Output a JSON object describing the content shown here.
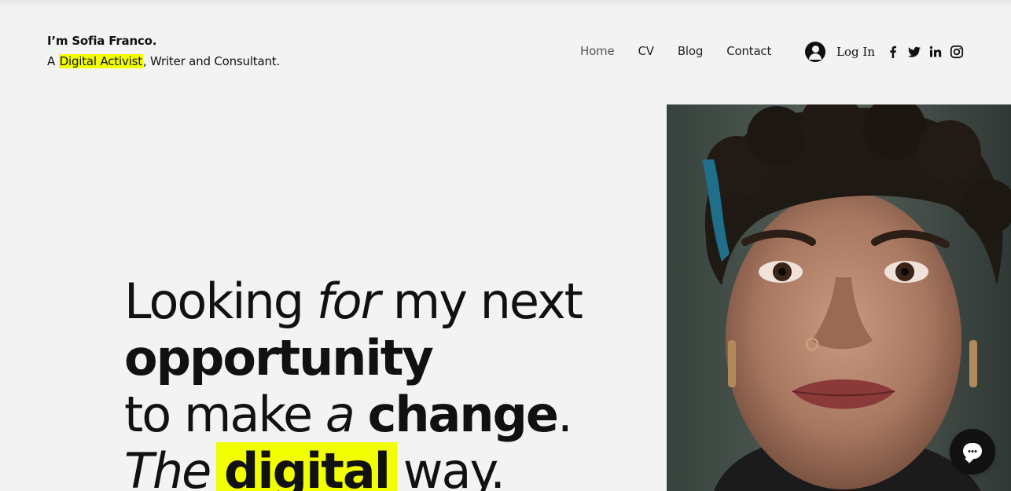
{
  "header": {
    "name": "I’m Sofia Franco.",
    "tagline_prefix": "A",
    "tagline_highlight": "Digital Activist",
    "tagline_suffix": ", Writer and Consultant."
  },
  "nav": {
    "items": [
      {
        "label": "Home",
        "active": true
      },
      {
        "label": "CV",
        "active": false
      },
      {
        "label": "Blog",
        "active": false
      },
      {
        "label": "Contact",
        "active": false
      }
    ],
    "login_label": "Log In",
    "social": [
      "facebook-icon",
      "twitter-icon",
      "linkedin-icon",
      "instagram-icon"
    ]
  },
  "hero": {
    "line1": {
      "a": "Looking",
      "b": "for",
      "c": "my next"
    },
    "line2": {
      "a": "opportunity"
    },
    "line3": {
      "a": "to make",
      "b": "a",
      "c": "change",
      "d": "."
    },
    "line4": {
      "a": "The",
      "b": "digital",
      "c": "way."
    }
  },
  "colors": {
    "accent": "#f2ff00",
    "background": "#f3f3f3",
    "text": "#111111"
  }
}
